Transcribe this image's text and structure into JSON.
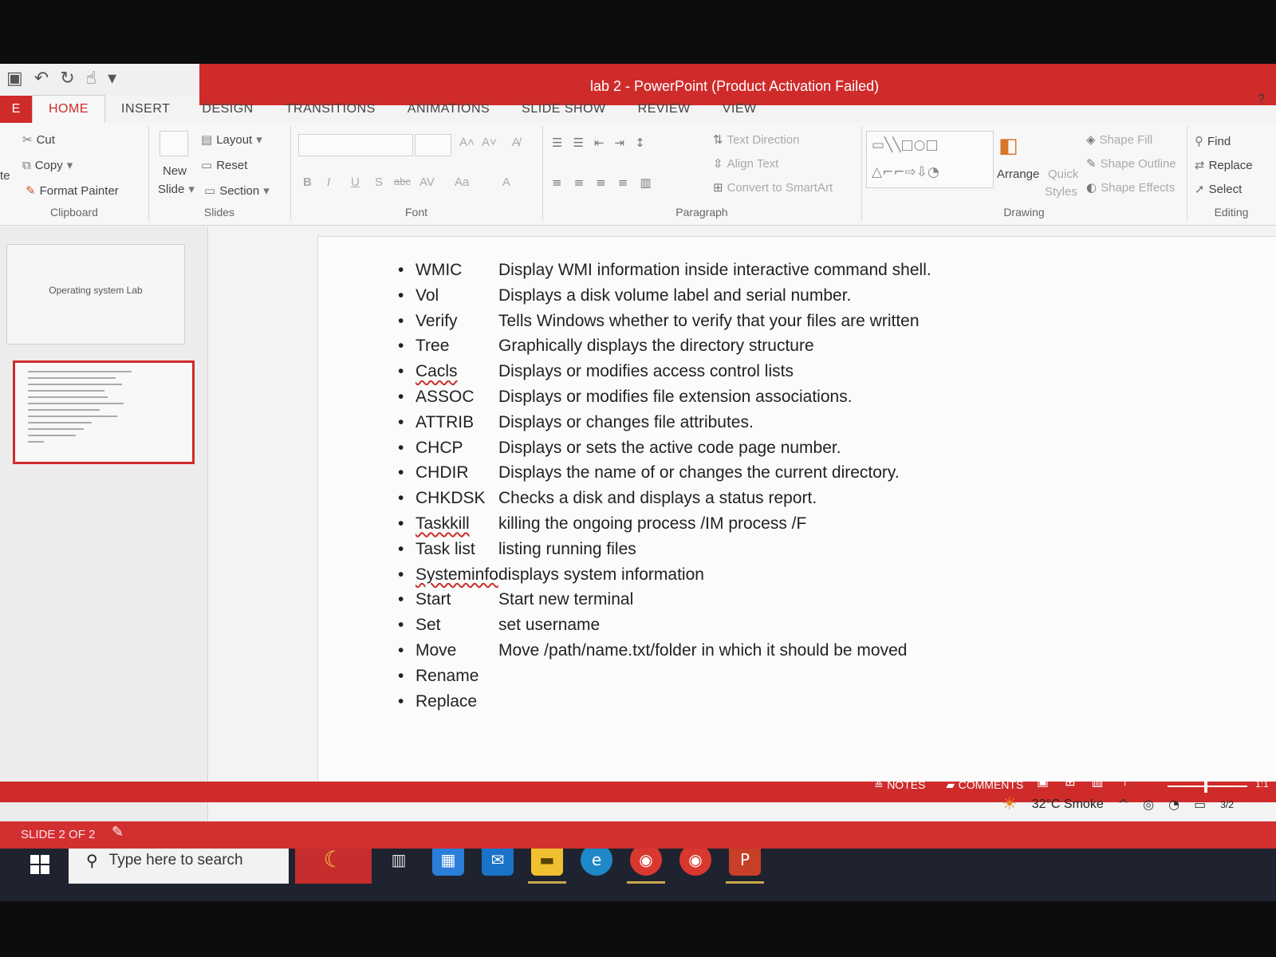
{
  "window": {
    "title": "lab 2 - PowerPoint (Product Activation Failed)",
    "help": "?"
  },
  "quick_access": [
    "save-icon",
    "undo-icon",
    "redo-icon",
    "touch-mode-icon",
    "customize-icon"
  ],
  "tabs": {
    "file": "E",
    "items": [
      "HOME",
      "INSERT",
      "DESIGN",
      "TRANSITIONS",
      "ANIMATIONS",
      "SLIDE SHOW",
      "REVIEW",
      "VIEW"
    ],
    "active": "HOME"
  },
  "ribbon": {
    "clipboard": {
      "label": "Clipboard",
      "paste": "te",
      "cut": "Cut",
      "copy": "Copy",
      "format_painter": "Format Painter"
    },
    "slides": {
      "label": "Slides",
      "new_slide_1": "New",
      "new_slide_2": "Slide",
      "layout": "Layout",
      "reset": "Reset",
      "section": "Section"
    },
    "font": {
      "label": "Font",
      "buttons": [
        "B",
        "I",
        "U",
        "S",
        "abc",
        "AV",
        "Aa",
        "A"
      ]
    },
    "paragraph": {
      "label": "Paragraph",
      "text_direction": "Text Direction",
      "align_text": "Align Text",
      "convert_smartart": "Convert to SmartArt"
    },
    "drawing": {
      "label": "Drawing",
      "arrange": "Arrange",
      "quick_styles_1": "Quick",
      "quick_styles_2": "Styles",
      "shape_fill": "Shape Fill",
      "shape_outline": "Shape Outline",
      "shape_effects": "Shape Effects"
    },
    "editing": {
      "label": "Editing",
      "find": "Find",
      "replace": "Replace",
      "select": "Select"
    }
  },
  "thumbnails": {
    "slide1_text": "Operating system Lab"
  },
  "slide": {
    "items": [
      {
        "cmd": "WMIC",
        "desc": "Display WMI information inside interactive command shell."
      },
      {
        "cmd": "Vol",
        "desc": "Displays a disk volume label and serial number."
      },
      {
        "cmd": "Verify",
        "desc": "Tells Windows whether to verify that your files are written"
      },
      {
        "cmd": "Tree",
        "desc": "Graphically displays the directory structure"
      },
      {
        "cmd": "Cacls",
        "desc": "Displays or modifies access control lists"
      },
      {
        "cmd": "ASSOC",
        "desc": "Displays or modifies file extension associations."
      },
      {
        "cmd": "ATTRIB",
        "desc": "Displays or changes file attributes."
      },
      {
        "cmd": "CHCP",
        "desc": "Displays or sets the active code page number."
      },
      {
        "cmd": "CHDIR",
        "desc": "Displays the name of or changes the current directory."
      },
      {
        "cmd": "CHKDSK",
        "desc": "Checks a disk and displays a status report."
      },
      {
        "cmd": "Taskkill",
        "desc": "killing the ongoing process /IM process /F"
      },
      {
        "cmd": "Task list",
        "desc": "listing running files"
      },
      {
        "cmd": "Systeminfo",
        "desc": "displays system information"
      },
      {
        "cmd": "Start",
        "desc": "Start new terminal"
      },
      {
        "cmd": "Set",
        "desc": "set username"
      },
      {
        "cmd": "Move",
        "desc": "Move /path/name.txt/folder in which it should be moved"
      },
      {
        "cmd": "Rename",
        "desc": ""
      },
      {
        "cmd": "Replace",
        "desc": ""
      }
    ]
  },
  "status": {
    "slide_count": "SLIDE 2 OF 2",
    "notes": "NOTES",
    "comments": "COMMENTS",
    "zoom": "1:1"
  },
  "taskbar": {
    "search_placeholder": "Type here to search",
    "weather": "32°C Smoke",
    "date": "3/2"
  },
  "colors": {
    "accent": "#cf2b2b",
    "taskbar": "#1f2330"
  }
}
